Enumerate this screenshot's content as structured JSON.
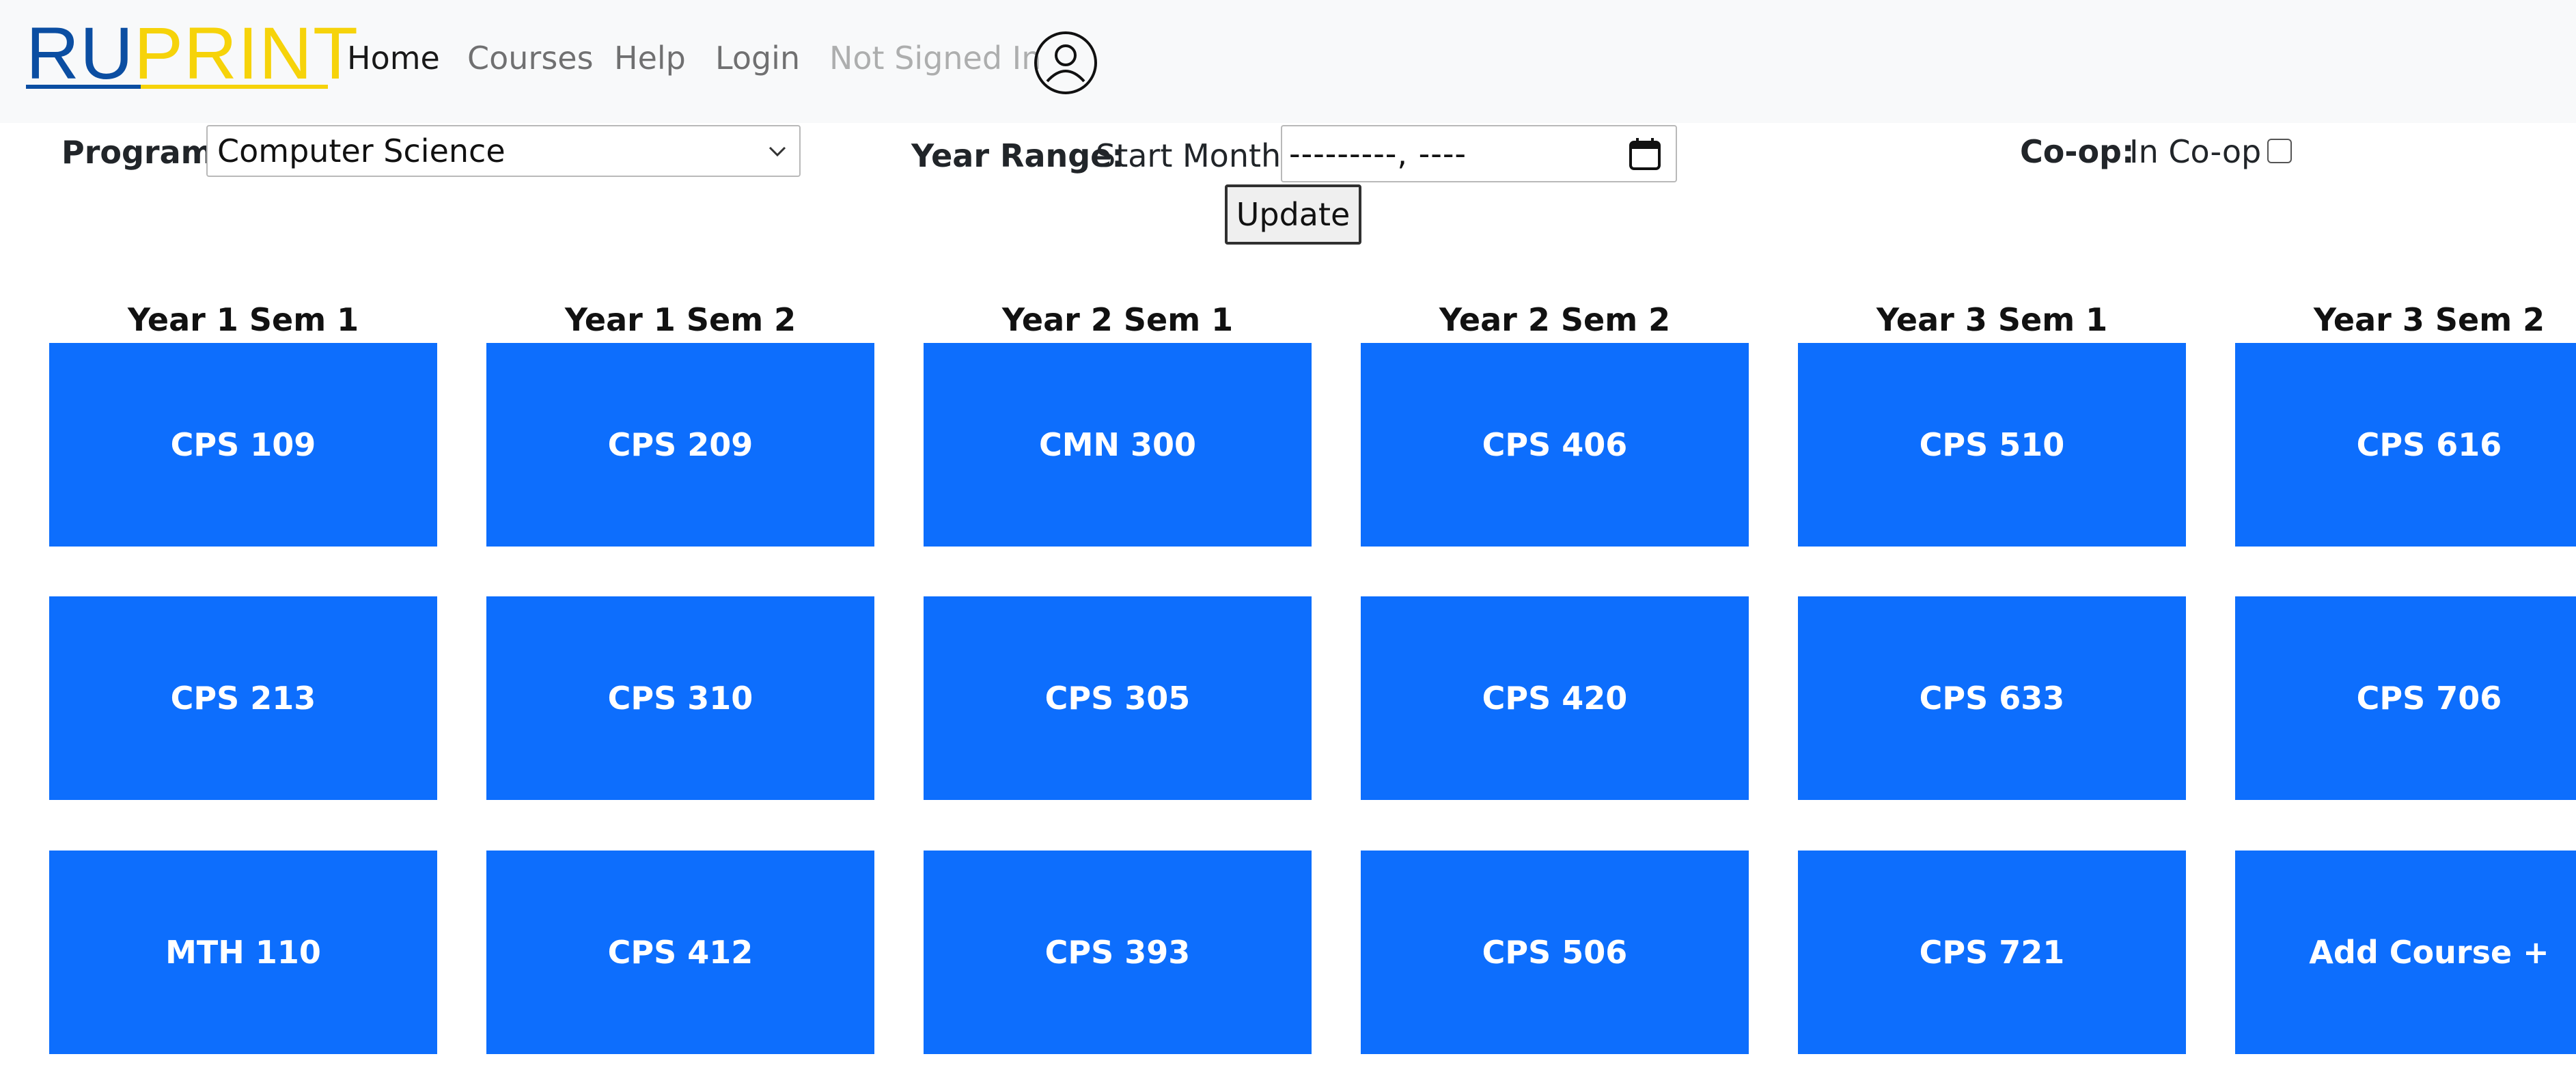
{
  "brand": {
    "part1": "RU",
    "part2": "PRINT"
  },
  "nav": {
    "links": [
      "Home",
      "Courses",
      "Help",
      "Login"
    ],
    "status": "Not Signed In"
  },
  "form": {
    "program_label": "Program:",
    "program_value": "Computer Science",
    "year_range_label": "Year Range:",
    "start_month_label": "Start Month:",
    "start_month_value": "---------, ----",
    "coop_label": "Co-op:",
    "coop_option": "In Co-op",
    "coop_checked": false,
    "update_label": "Update"
  },
  "semesters": [
    {
      "title": "Year 1 Sem 1",
      "courses": [
        "CPS 109",
        "CPS 213",
        "MTH 110"
      ]
    },
    {
      "title": "Year 1 Sem 2",
      "courses": [
        "CPS 209",
        "CPS 310",
        "CPS 412"
      ]
    },
    {
      "title": "Year 2 Sem 1",
      "courses": [
        "CMN 300",
        "CPS 305",
        "CPS 393"
      ]
    },
    {
      "title": "Year 2 Sem 2",
      "courses": [
        "CPS 406",
        "CPS 420",
        "CPS 506"
      ]
    },
    {
      "title": "Year 3 Sem 1",
      "courses": [
        "CPS 510",
        "CPS 633",
        "CPS 721"
      ]
    },
    {
      "title": "Year 3 Sem 2",
      "courses": [
        "CPS 616",
        "CPS 706",
        "Add Course +"
      ]
    }
  ],
  "colors": {
    "course_tile": "#0d6efd",
    "navbar_bg": "#f8f9fa",
    "brand_blue": "#0b4ea2",
    "brand_yellow": "#f6d30a"
  },
  "icons": {
    "user": "user-circle-icon",
    "select": "chevron-down-icon",
    "date": "calendar-icon"
  }
}
